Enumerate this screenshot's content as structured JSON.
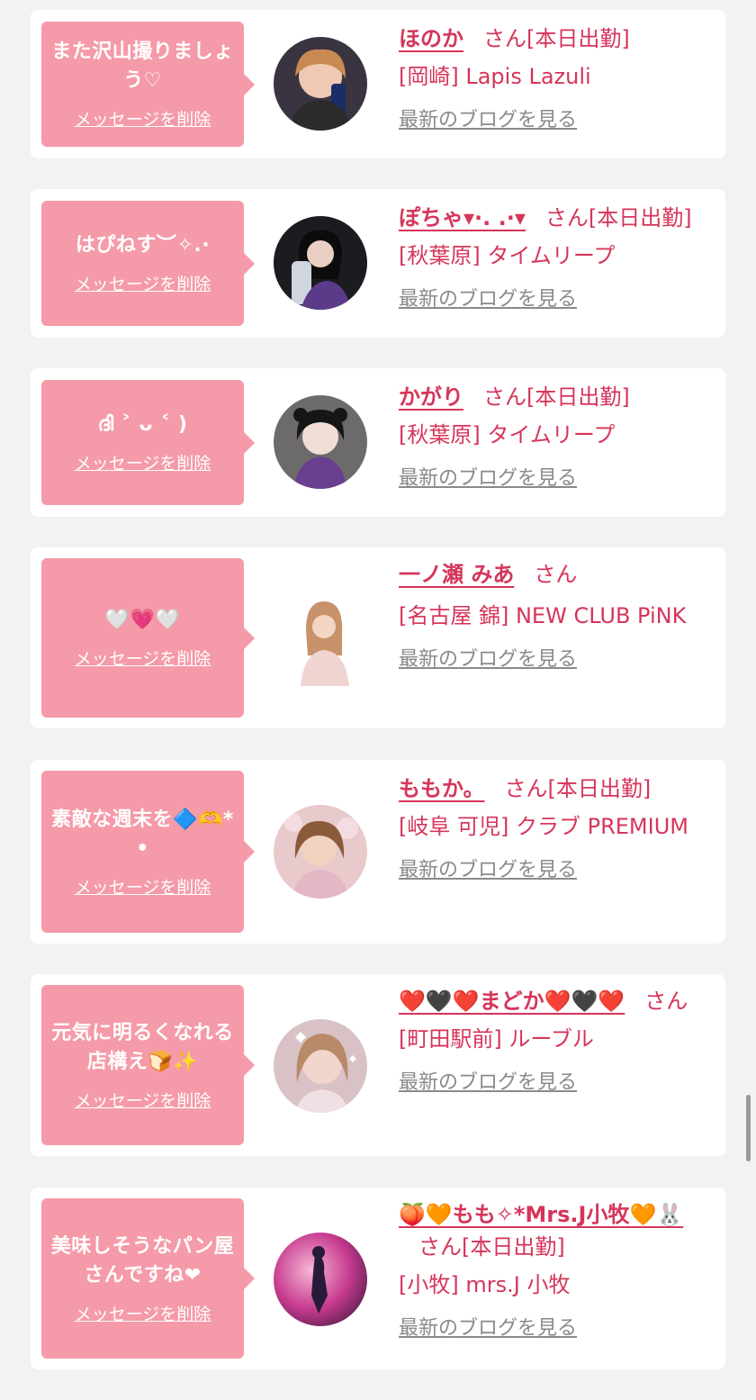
{
  "delete_label": "メッセージを削除",
  "blog_label": "最新のブログを見る",
  "san_label": "さん",
  "today_label": "[本日出勤]",
  "colors": {
    "accent": "#d6355a",
    "bubble": "#f59aa8",
    "card": "#ffffff",
    "background": "#f2f2f2",
    "muted": "#8a8a8a"
  },
  "cards": [
    {
      "message": "また沢山撮りましょう♡",
      "name": "ほのか",
      "today": true,
      "shop": "[岡崎] Lapis Lazuli",
      "avatar_icon": "avatar-photo-icon"
    },
    {
      "message": "はぴねす︶✧.·",
      "name": "ぽちゃ▾·. .·▾",
      "today": true,
      "shop": "[秋葉原] タイムリープ",
      "avatar_icon": "avatar-photo-icon"
    },
    {
      "message": "ദി ˃ ᴗ ˂ )",
      "name": "かがり",
      "today": true,
      "shop": "[秋葉原] タイムリープ",
      "avatar_icon": "avatar-photo-icon"
    },
    {
      "message": "🤍💗🤍",
      "name": "一ノ瀬 みあ",
      "today": false,
      "shop": "[名古屋 錦] NEW CLUB PiNK",
      "avatar_icon": "avatar-photo-icon"
    },
    {
      "message": "素敵な週末を🔷🫶*•",
      "name": "ももか。",
      "today": true,
      "shop": "[岐阜 可児] クラブ PREMIUM",
      "avatar_icon": "avatar-photo-icon"
    },
    {
      "message": "元気に明るくなれる店構え🍞✨",
      "name": "❤️🖤❤️まどか❤️🖤❤️",
      "today": false,
      "shop": "[町田駅前] ルーブル",
      "avatar_icon": "avatar-photo-icon"
    },
    {
      "message": "美味しそうなパン屋さんですね❤",
      "name": "🍑🧡もも✧*Mrs.J小牧🧡🐰",
      "today": true,
      "shop": "[小牧] mrs.J 小牧",
      "avatar_icon": "avatar-photo-icon"
    }
  ]
}
